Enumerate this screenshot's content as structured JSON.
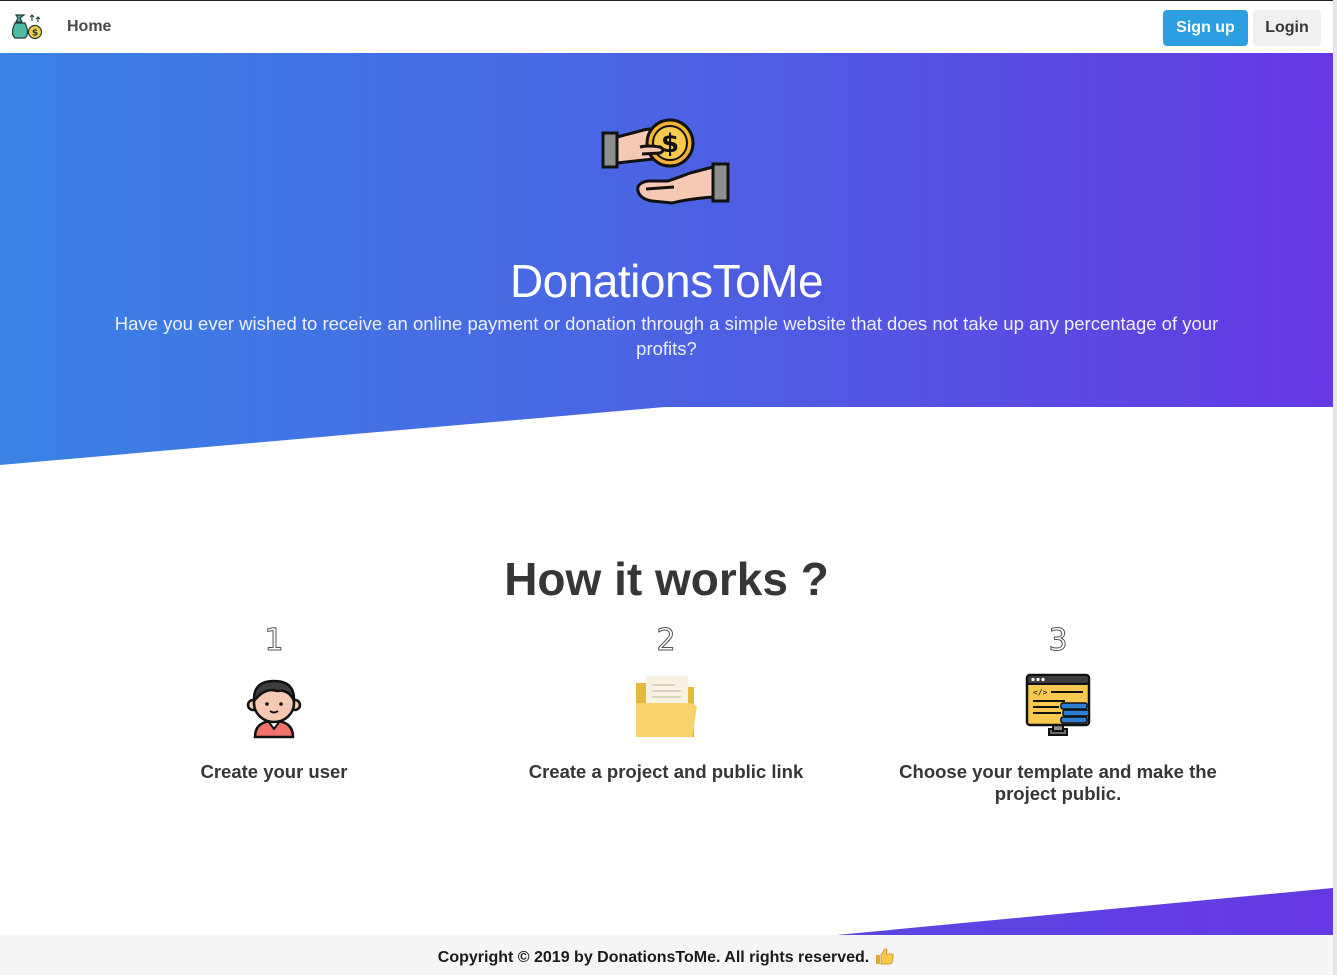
{
  "navbar": {
    "logo_icon": "money-bag-icon",
    "home_label": "Home",
    "signup_label": "Sign up",
    "login_label": "Login"
  },
  "hero": {
    "icon": "hand-giving-coin-icon",
    "title": "DonationsToMe",
    "subtitle": "Have you ever wished to receive an online payment or donation through a simple website that does not take up any percentage of your profits?"
  },
  "how": {
    "title": "How it works ?",
    "steps": [
      {
        "number": "1",
        "icon": "user-avatar-icon",
        "label": "Create your user"
      },
      {
        "number": "2",
        "icon": "folder-icon",
        "label": "Create a project and public link"
      },
      {
        "number": "3",
        "icon": "code-template-icon",
        "label": "Choose your template and make the project public."
      }
    ]
  },
  "footer": {
    "text": "Copyright © 2019 by DonationsToMe. All rights reserved.",
    "icon": "thumbs-up-icon"
  },
  "colors": {
    "gradient_start": "#3a82e4",
    "gradient_end": "#6538e2",
    "signup_button": "#2c9fe2"
  }
}
